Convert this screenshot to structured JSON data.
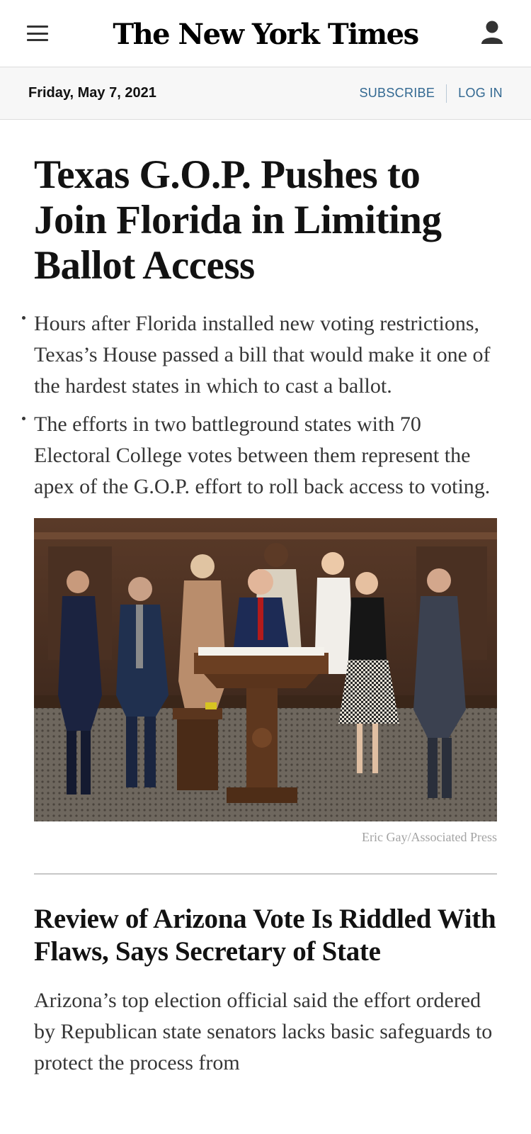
{
  "masthead": {
    "logo_text": "The New York Times",
    "menu_icon": "hamburger-menu-icon",
    "user_icon": "user-account-icon"
  },
  "datebar": {
    "date": "Friday, May 7, 2021",
    "subscribe_label": "SUBSCRIBE",
    "login_label": "LOG IN",
    "link_color": "#326891"
  },
  "lead_story": {
    "headline": "Texas G.O.P. Pushes to Join Florida in Limiting Ballot Access",
    "summary": [
      "Hours after Florida installed new voting restrictions, Texas’s House passed a bill that would make it one of the hardest states in which to cast a ballot.",
      "The efforts in two battleground states with 70 Electoral College votes between them represent the apex of the G.O.P. effort to roll back access to voting."
    ],
    "photo_credit": "Eric Gay/Associated Press"
  },
  "second_story": {
    "headline": "Review of Arizona Vote Is Riddled With Flaws, Says Secretary of State",
    "summary": "Arizona’s top election official said the effort ordered by Republican state senators lacks basic safeguards to protect the process from"
  }
}
